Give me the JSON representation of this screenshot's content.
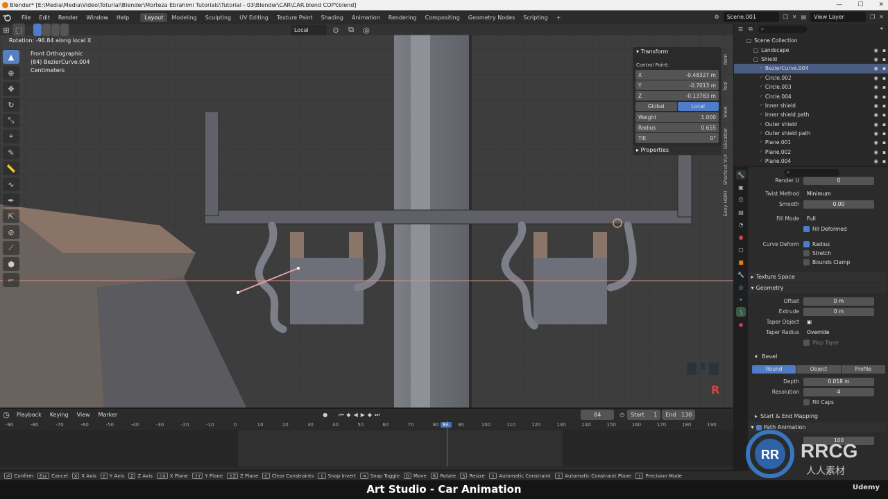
{
  "titlebar": {
    "title": "Blender* [E:\\Media\\Media\\Video\\Toturial\\Blender\\Morteza Ebrahimi Tutorials\\Tutorial - 03\\Blender\\CAR\\CAR.blend COPY.blend]",
    "minimize": "—",
    "maximize": "☐",
    "close": "✕"
  },
  "menu": {
    "items": [
      "File",
      "Edit",
      "Render",
      "Window",
      "Help"
    ]
  },
  "workspaces": [
    "Layout",
    "Modeling",
    "Sculpting",
    "UV Editing",
    "Texture Paint",
    "Shading",
    "Animation",
    "Rendering",
    "Compositing",
    "Geometry Nodes",
    "Scripting",
    "+"
  ],
  "scene": {
    "name": "Scene.001",
    "view_layer": "View Layer"
  },
  "viewport": {
    "orientation": "Local",
    "status_line": "Rotation: -96.84 along local X",
    "view_name": "Front Orthographic",
    "object_info": "(84) BezierCurve.004",
    "units": "Centimeters",
    "r_mark": "R"
  },
  "npanel": {
    "header": "Transform",
    "control_point": "Control Point:",
    "x_label": "X",
    "x_value": "-0.48327 m",
    "y_label": "Y",
    "y_value": "-0.7013 m",
    "z_label": "Z",
    "z_value": "-0.13783 m",
    "global": "Global",
    "local": "Local",
    "weight_label": "Weight",
    "weight_value": "1.000",
    "radius_label": "Radius",
    "radius_value": "0.655",
    "tilt_label": "Tilt",
    "tilt_value": "0°",
    "properties": "Properties"
  },
  "side_tabs": [
    "Item",
    "Tool",
    "View",
    "GScatter",
    "Shortcut VUr",
    "Easy HDRI"
  ],
  "outliner": {
    "search_placeholder": "",
    "rows": [
      {
        "name": "Scene Collection",
        "indent": 0
      },
      {
        "name": "Landscape",
        "indent": 1
      },
      {
        "name": "Shield",
        "indent": 1
      },
      {
        "name": "BezierCurve.004",
        "indent": 2
      },
      {
        "name": "Circle.002",
        "indent": 2
      },
      {
        "name": "Circle.003",
        "indent": 2
      },
      {
        "name": "Circle.004",
        "indent": 2
      },
      {
        "name": "Inner shield",
        "indent": 2
      },
      {
        "name": "Inner shield path",
        "indent": 2
      },
      {
        "name": "Outer shield",
        "indent": 2
      },
      {
        "name": "Outer shield path",
        "indent": 2
      },
      {
        "name": "Plane.001",
        "indent": 2
      },
      {
        "name": "Plane.002",
        "indent": 2
      },
      {
        "name": "Plane.004",
        "indent": 2
      }
    ]
  },
  "props": {
    "render_u_label": "Render U",
    "render_u_value": "0",
    "twist_label": "Twist Method",
    "twist_value": "Minimum",
    "smooth_label": "Smooth",
    "smooth_value": "0.00",
    "fill_mode_label": "Fill Mode",
    "fill_mode_value": "Full",
    "fill_deformed": "Fill Deformed",
    "curve_deform_label": "Curve Deform",
    "radius": "Radius",
    "stretch": "Stretch",
    "bounds_clamp": "Bounds Clamp",
    "texture_space": "Texture Space",
    "geometry": "Geometry",
    "offset_label": "Offset",
    "offset_value": "0 m",
    "extrude_label": "Extrude",
    "extrude_value": "0 m",
    "taper_obj_label": "Taper Object",
    "taper_radius_label": "Taper Radius",
    "taper_radius_value": "Override",
    "map_taper": "Map Taper",
    "bevel": "Bevel",
    "bevel_tabs": [
      "Round",
      "Object",
      "Profile"
    ],
    "depth_label": "Depth",
    "depth_value": "0.018 m",
    "resolution_label": "Resolution",
    "resolution_value": "4",
    "fill_caps": "Fill Caps",
    "start_end": "Start & End Mapping",
    "path_anim": "Path Animation",
    "frames_value": "100"
  },
  "timeline": {
    "menus": [
      "Playback",
      "Keying",
      "View",
      "Marker"
    ],
    "current_frame": "84",
    "start_label": "Start",
    "start_value": "1",
    "end_label": "End",
    "end_value": "130",
    "ticks": [
      "-90",
      "-80",
      "-70",
      "-60",
      "-50",
      "-40",
      "-30",
      "-20",
      "-10",
      "0",
      "10",
      "20",
      "30",
      "40",
      "50",
      "60",
      "70",
      "80",
      "84",
      "90",
      "100",
      "110",
      "120",
      "130",
      "140",
      "150",
      "160",
      "170",
      "180",
      "190"
    ]
  },
  "statusbar": {
    "items": [
      {
        "key": "⏎",
        "label": "Confirm"
      },
      {
        "key": "Esc",
        "label": "Cancel"
      },
      {
        "key": "X",
        "label": "X Axis"
      },
      {
        "key": "Y",
        "label": "Y Axis"
      },
      {
        "key": "Z",
        "label": "Z Axis"
      },
      {
        "key": "⇧X",
        "label": "X Plane"
      },
      {
        "key": "⇧Y",
        "label": "Y Plane"
      },
      {
        "key": "⇧Z",
        "label": "Z Plane"
      },
      {
        "key": "C",
        "label": "Clear Constraints"
      },
      {
        "key": "⇧",
        "label": "Snap Invert"
      },
      {
        "key": "⇥",
        "label": "Snap Toggle"
      },
      {
        "key": "G",
        "label": "Move"
      },
      {
        "key": "R",
        "label": "Rotate"
      },
      {
        "key": "S",
        "label": "Resize"
      },
      {
        "key": "⇧",
        "label": "Automatic Constraint"
      },
      {
        "key": "⇧",
        "label": "Automatic Constraint Plane"
      },
      {
        "key": "⇧",
        "label": "Precision Mode"
      }
    ]
  },
  "banner": {
    "title": "Art Studio - Car Animation",
    "brand": "Udemy"
  },
  "watermark": {
    "logo": "RRCG",
    "subtitle": "人人素材"
  },
  "colors": {
    "accent": "#4f7cc9",
    "selection": "#e87d0d",
    "active_frame": "#4772b3"
  }
}
